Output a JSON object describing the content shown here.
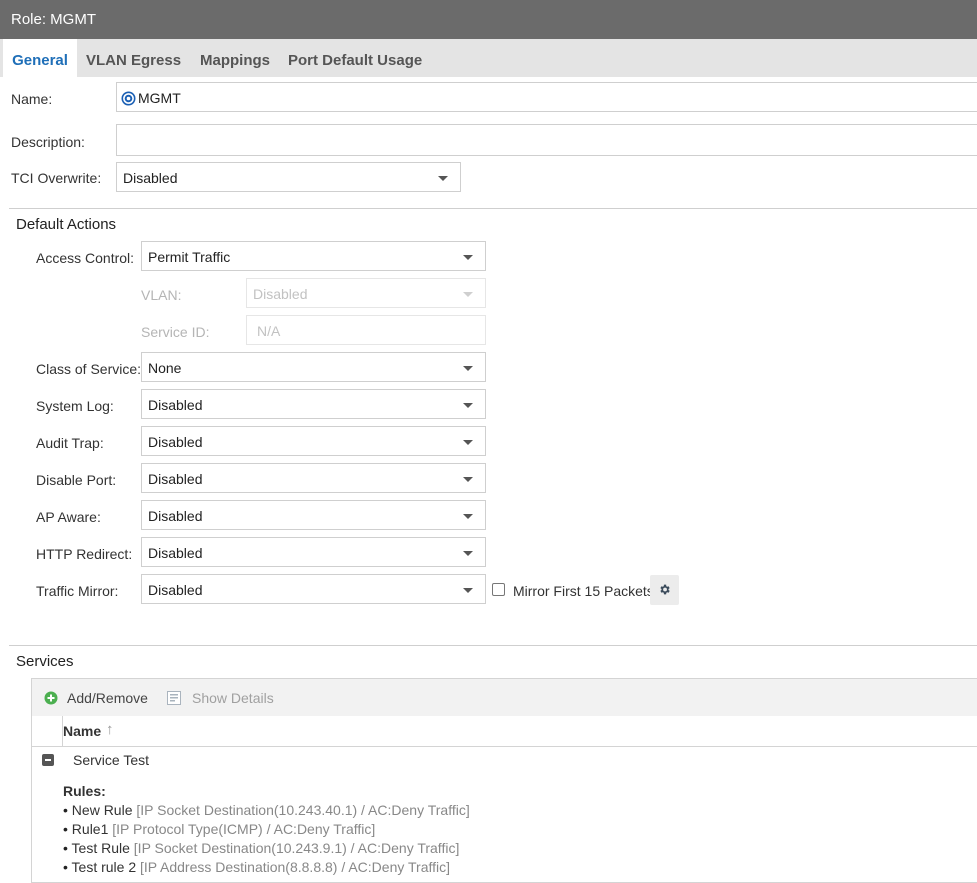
{
  "window": {
    "title": "Role: MGMT"
  },
  "tabs": [
    {
      "label": "General",
      "active": true
    },
    {
      "label": "VLAN Egress",
      "active": false
    },
    {
      "label": "Mappings",
      "active": false
    },
    {
      "label": "Port Default Usage",
      "active": false
    }
  ],
  "general": {
    "name_label": "Name:",
    "name_value": "MGMT",
    "name_icon": "role-icon",
    "description_label": "Description:",
    "description_value": "",
    "tci_label": "TCI Overwrite:",
    "tci_value": "Disabled"
  },
  "default_actions": {
    "title": "Default Actions",
    "access_control": {
      "label": "Access Control:",
      "value": "Permit Traffic"
    },
    "vlan": {
      "label": "VLAN:",
      "value": "Disabled"
    },
    "service_id": {
      "label": "Service ID:",
      "placeholder": "N/A"
    },
    "class_of_service": {
      "label": "Class of Service:",
      "value": "None"
    },
    "system_log": {
      "label": "System Log:",
      "value": "Disabled"
    },
    "audit_trap": {
      "label": "Audit Trap:",
      "value": "Disabled"
    },
    "disable_port": {
      "label": "Disable Port:",
      "value": "Disabled"
    },
    "ap_aware": {
      "label": "AP Aware:",
      "value": "Disabled"
    },
    "http_redirect": {
      "label": "HTTP Redirect:",
      "value": "Disabled"
    },
    "traffic_mirror": {
      "label": "Traffic Mirror:",
      "value": "Disabled"
    },
    "mirror_first": {
      "label": "Mirror First 15 Packets",
      "checked": false
    }
  },
  "services": {
    "title": "Services",
    "add_remove_label": "Add/Remove",
    "show_details_label": "Show Details",
    "column_name": "Name",
    "sort_indicator": "↑",
    "group": {
      "name": "Service Test",
      "rules_label": "Rules:",
      "rules": [
        {
          "name": "New Rule",
          "detail": "[IP Socket Destination(10.243.40.1) / AC:Deny Traffic]"
        },
        {
          "name": "Rule1",
          "detail": "[IP Protocol Type(ICMP) / AC:Deny Traffic]"
        },
        {
          "name": "Test Rule",
          "detail": "[IP Socket Destination(10.243.9.1) / AC:Deny Traffic]"
        },
        {
          "name": "Test rule 2",
          "detail": "[IP Address Destination(8.8.8.8) / AC:Deny Traffic]"
        }
      ]
    }
  },
  "colors": {
    "accent": "#1f6fb8",
    "titlebar": "#6b6b6b",
    "add_green": "#4caf50"
  }
}
